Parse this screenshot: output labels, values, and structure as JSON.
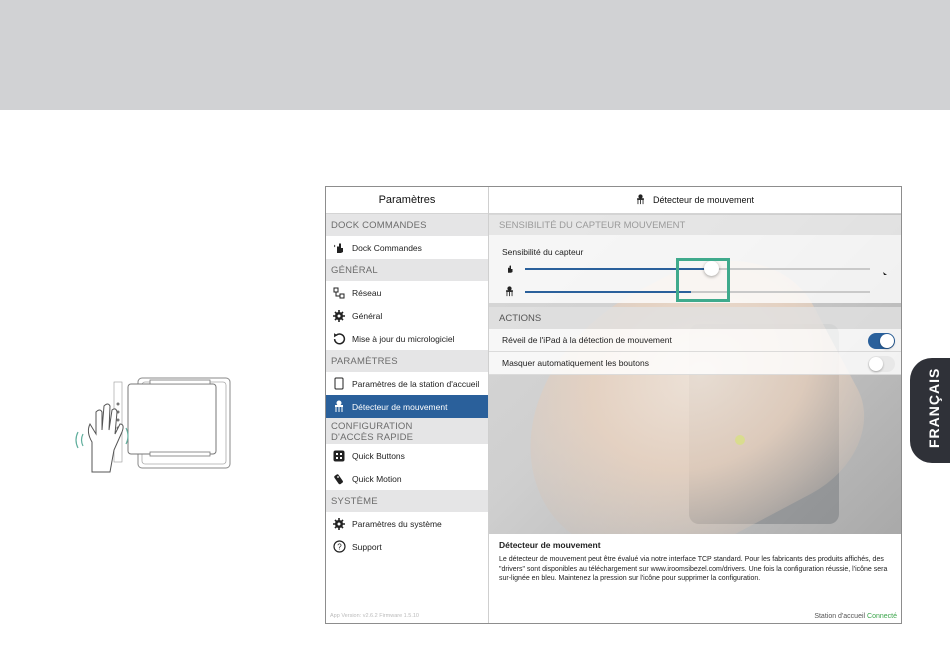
{
  "language_tab": "FRANÇAIS",
  "settings": {
    "left_title": "Paramètres",
    "sections": [
      {
        "header": "DOCK COMMANDES",
        "items": [
          {
            "label": "Dock Commandes",
            "icon": "hand-pointer-icon"
          }
        ]
      },
      {
        "header": "GÉNÉRAL",
        "items": [
          {
            "label": "Réseau",
            "icon": "network-icon"
          },
          {
            "label": "Général",
            "icon": "gear-icon"
          },
          {
            "label": "Mise à jour du micrologiciel",
            "icon": "refresh-icon"
          }
        ]
      },
      {
        "header": "PARAMÈTRES",
        "items": [
          {
            "label": "Paramètres de la station d'accueil",
            "icon": "tablet-icon"
          },
          {
            "label": "Détecteur de mouvement",
            "icon": "motion-sensor-icon",
            "selected": true
          }
        ]
      },
      {
        "header_line1": "CONFIGURATION",
        "header_line2": "D'ACCÈS RAPIDE",
        "items": [
          {
            "label": "Quick Buttons",
            "icon": "grid-icon"
          },
          {
            "label": "Quick Motion",
            "icon": "remote-icon"
          }
        ]
      },
      {
        "header": "SYSTÈME",
        "items": [
          {
            "label": "Paramètres du système",
            "icon": "gear-icon"
          },
          {
            "label": "Support",
            "icon": "question-icon"
          }
        ]
      }
    ],
    "left_footer": "App Version: v2.6.2 Firmware 1.5.10"
  },
  "detail": {
    "title": "Détecteur de mouvement",
    "sensitivity_header": "SENSIBILITÉ DU CAPTEUR MOUVEMENT",
    "sensitivity_label": "Sensibilité du capteur",
    "slider_top_level": 0.54,
    "slider_bottom_level": 0.48,
    "actions_header": "ACTIONS",
    "actions": [
      {
        "label": "Réveil de l'iPad à la détection de mouvement",
        "on": true
      },
      {
        "label": "Masquer automatiquement les boutons",
        "on": false
      }
    ],
    "info_title": "Détecteur de mouvement",
    "info_body": "Le détecteur de mouvement peut être évalué via notre interface TCP standard. Pour les fabricants des produits affichés, des \"drivers\" sont disponibles au téléchargement sur www.iroomsibezel.com/drivers. Une fois la configuration réussie, l'icône sera sur-lignée en bleu. Maintenez la pression sur l'icône pour supprimer la configuration.",
    "status_label": "Station d'accueil",
    "status_value": "Connecté"
  },
  "colors": {
    "accent": "#2a609b",
    "highlight": "#3faa8c",
    "connected": "#3aa54a",
    "tab": "#2f3138"
  }
}
